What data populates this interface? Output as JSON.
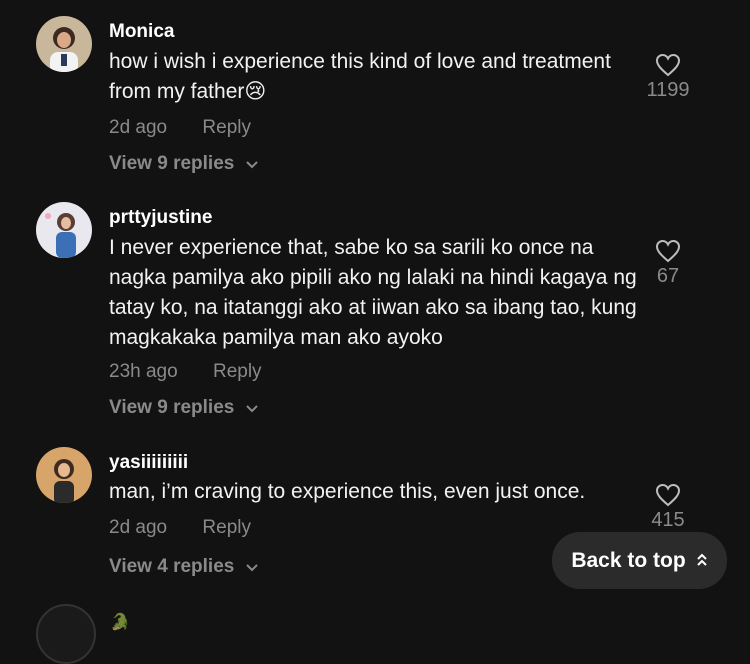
{
  "comments": [
    {
      "username": "Monica",
      "text": "how i wish i experience this kind of love and treatment from my father😢",
      "time": "2d ago",
      "reply_label": "Reply",
      "view_replies": "View 9 replies",
      "likes": "1199"
    },
    {
      "username": "prttyjustine",
      "text": "I never experience that, sabe ko sa sarili ko once na nagka pamilya ako pipili ako ng lalaki na hindi kagaya ng tatay ko, na itatanggi ako at iiwan ako sa ibang tao, kung magkakaka pamilya man ako ayoko",
      "time": "23h ago",
      "reply_label": "Reply",
      "view_replies": "View 9 replies",
      "likes": "67"
    },
    {
      "username": "yasiiiiiiiii",
      "text": "man, i’m craving to experience this, even just once.",
      "time": "2d ago",
      "reply_label": "Reply",
      "view_replies": "View 4 replies",
      "likes": "415"
    }
  ],
  "back_to_top": "Back to top",
  "colors": {
    "background": "#121212",
    "muted": "#8a8a8a",
    "pill": "#2b2b2b"
  }
}
